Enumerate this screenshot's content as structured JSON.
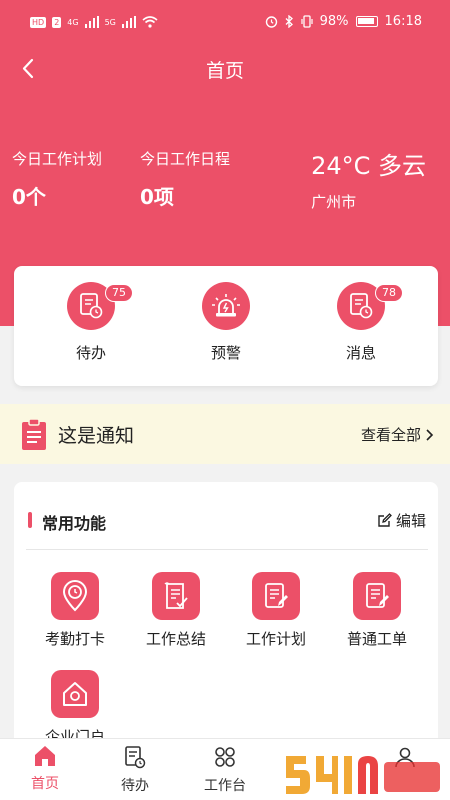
{
  "status_bar": {
    "left_badges": [
      "HD",
      "2",
      "4G",
      "5G"
    ],
    "battery": "98%",
    "time": "16:18"
  },
  "nav": {
    "title": "首页"
  },
  "stats": [
    {
      "label": "今日工作计划",
      "value": "0个"
    },
    {
      "label": "今日工作日程",
      "value": "0项"
    }
  ],
  "weather": {
    "temp": "24°C 多云",
    "city": "广州市"
  },
  "quick": [
    {
      "label": "待办",
      "badge": "75",
      "icon": "todo-icon"
    },
    {
      "label": "预警",
      "badge": "",
      "icon": "alarm-icon"
    },
    {
      "label": "消息",
      "badge": "78",
      "icon": "message-icon"
    }
  ],
  "notice": {
    "text": "这是通知",
    "more": "查看全部"
  },
  "functions": {
    "title": "常用功能",
    "edit": "编辑",
    "items": [
      {
        "label": "考勤打卡",
        "icon": "location-pin-icon"
      },
      {
        "label": "工作总结",
        "icon": "summary-doc-icon"
      },
      {
        "label": "工作计划",
        "icon": "plan-doc-icon"
      },
      {
        "label": "普通工单",
        "icon": "workorder-doc-icon"
      },
      {
        "label": "企业门户",
        "icon": "home-icon"
      }
    ]
  },
  "tabs": [
    {
      "label": "首页",
      "active": true
    },
    {
      "label": "待办",
      "active": false
    },
    {
      "label": "工作台",
      "active": false
    },
    {
      "label": "",
      "active": false
    },
    {
      "label": "",
      "active": false
    }
  ],
  "colors": {
    "primary": "#ec5068",
    "notice_bg": "#fbf8e1",
    "page_bg": "#f2f2f2"
  }
}
